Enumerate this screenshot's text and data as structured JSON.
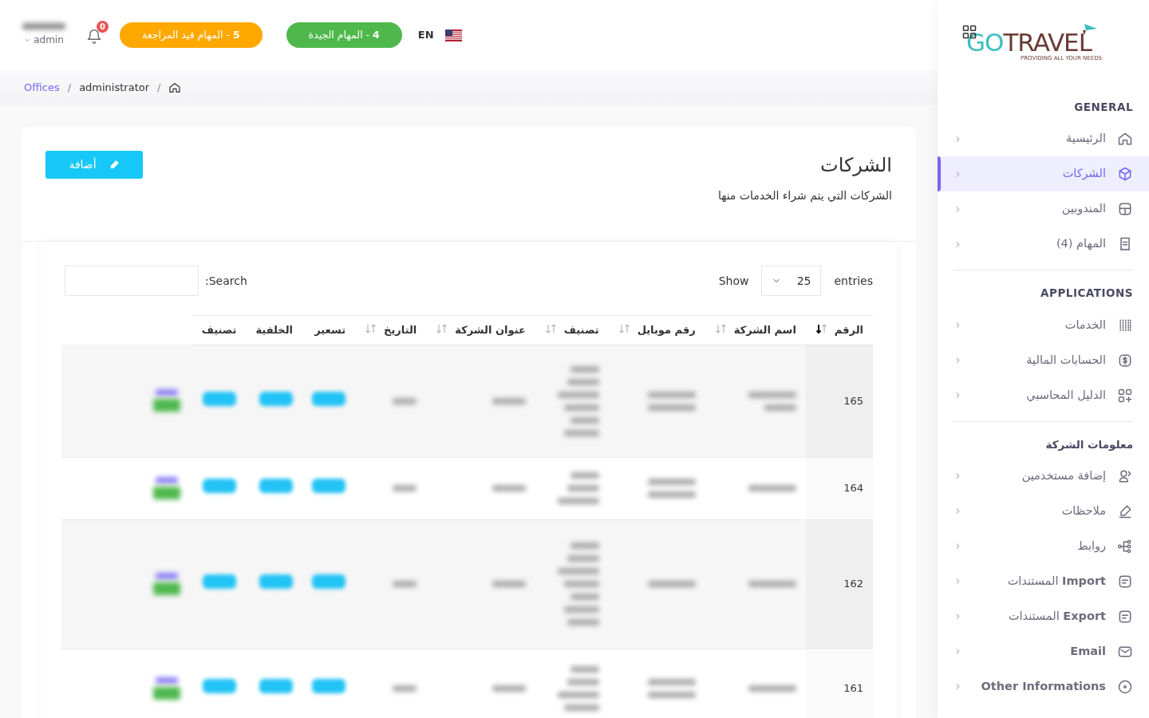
{
  "header": {
    "user_role": "admin",
    "notifications": "0",
    "pills": [
      {
        "label": "**4** - المهام الجيدة",
        "color": "#4fb84d"
      },
      {
        "label": "**5** - المهام قيد المراجعة",
        "color": "#ffa800"
      }
    ],
    "language": "EN"
  },
  "breadcrumb": [
    {
      "kind": "home"
    },
    {
      "label": "/",
      "kind": "separator"
    },
    {
      "label": "administrator",
      "kind": "text"
    },
    {
      "label": "/",
      "kind": "separator"
    },
    {
      "label": "Offices",
      "kind": "link"
    }
  ],
  "page": {
    "title": "الشركات",
    "subtitle": "الشركات التي يتم شراء الخدمات منها",
    "add_button": "أضافة"
  },
  "table_controls": {
    "show": "Show",
    "page_size": "25",
    "entries": "entries",
    "search_label": "Search:"
  },
  "table": {
    "columns": [
      {
        "label": "الرقم",
        "sortable": true,
        "sorted": true
      },
      {
        "label": "اسم الشركة",
        "sortable": true,
        "sorted": false
      },
      {
        "label": "رقم موبايل",
        "sortable": true,
        "sorted": false
      },
      {
        "label": "تصنيف",
        "sortable": true,
        "sorted": false
      },
      {
        "label": "عنوان الشركة",
        "sortable": true,
        "sorted": false
      },
      {
        "label": "التاريخ",
        "sortable": true,
        "sorted": false
      },
      {
        "label": "تسعير",
        "sortable": false
      },
      {
        "label": "الخلفية",
        "sortable": false
      },
      {
        "label": "تصنيف",
        "sortable": false
      }
    ],
    "rows": [
      {
        "number": "165",
        "shaded": true,
        "kind": "tall"
      },
      {
        "number": "164",
        "shaded": false,
        "kind": "short"
      },
      {
        "number": "162",
        "shaded": true,
        "kind": "xtall"
      },
      {
        "number": "161",
        "shaded": false,
        "kind": "cut"
      }
    ]
  },
  "sidebar": {
    "logo": {
      "first": "GO",
      "second": "TRAVEL",
      "tagline": "PROVIDING ALL YOUR NEEDS"
    },
    "sections": [
      {
        "title": "GENERAL",
        "items": [
          {
            "label": "الرئيسية",
            "selected": false
          },
          {
            "label": "الشركات",
            "selected": true
          },
          {
            "label": "المندوبين",
            "selected": false
          },
          {
            "label": "المهام (4)",
            "selected": false
          }
        ]
      },
      {
        "title": "APPLICATIONS",
        "items": [
          {
            "label": "الخدمات",
            "selected": false
          },
          {
            "label": "الحسابات المالية",
            "selected": false
          },
          {
            "label": "الدليل المحاسبي",
            "selected": false
          }
        ]
      },
      {
        "title": "معلومات الشركة",
        "items": [
          {
            "label": "إضافة مستخدمين",
            "selected": false
          },
          {
            "label": "ملاحظات",
            "selected": false
          },
          {
            "label": "روابط",
            "selected": false
          },
          {
            "label": "**Import** المستندات",
            "selected": false
          },
          {
            "label": "**Export** المستندات",
            "selected": false
          },
          {
            "label": "Email",
            "selected": false,
            "bold": true
          },
          {
            "label": "Other Informations",
            "selected": false,
            "bold": true
          }
        ]
      }
    ]
  }
}
